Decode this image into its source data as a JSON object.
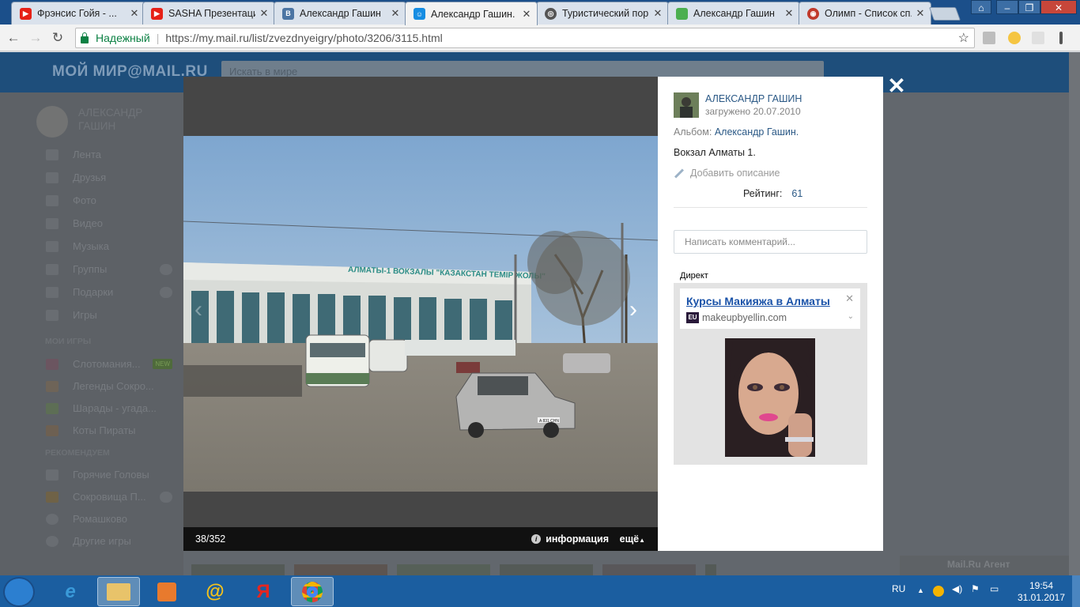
{
  "browser": {
    "tabs": [
      {
        "title": "Фрэнсис Гойя - ...",
        "icon": "youtube-icon",
        "color": "#e62117"
      },
      {
        "title": "SASHA Презентаци...",
        "icon": "youtube-icon",
        "color": "#e62117"
      },
      {
        "title": "Александр Гашин",
        "icon": "vk-icon",
        "color": "#4c75a3"
      },
      {
        "title": "Александр Гашин.",
        "icon": "mailru-icon",
        "color": "#168de2"
      },
      {
        "title": "Туристический пор...",
        "icon": "globe-icon",
        "color": "#555555"
      },
      {
        "title": "Александр Гашин",
        "icon": "page-icon",
        "color": "#4caf50"
      },
      {
        "title": "Олимп - Список сп...",
        "icon": "olimp-icon",
        "color": "#c0392b"
      }
    ],
    "active_tab": 3,
    "secure_label": "Надежный",
    "url": "https://my.mail.ru/list/zvezdnyeigry/photo/3206/3115.html"
  },
  "mymail": {
    "logo": "МОЙ МИР@MAIL.RU",
    "search_placeholder": "Искать в мире",
    "user_name": "АЛЕКСАНДР ГАШИН",
    "menu": [
      "Лента",
      "Друзья",
      "Фото",
      "Видео",
      "Музыка",
      "Группы",
      "Подарки",
      "Игры"
    ],
    "my_games_title": "МОИ ИГРЫ",
    "my_games": [
      "Слотомания...",
      "Легенды Сокро...",
      "Шарады - угада...",
      "Коты Пираты"
    ],
    "new_badge": "NEW",
    "recommend_title": "РЕКОМЕНДУЕМ",
    "recommended": [
      "Горячие Головы",
      "Сокровища П...",
      "Ромашково",
      "Другие игры"
    ],
    "agent_label": "Mail.Ru Агент"
  },
  "viewer": {
    "counter": "38/352",
    "info_label": "информация",
    "more_label": "ещё",
    "sign_text": "АЛМАТЫ-1 ВОКЗАЛЫ \"КАЗАКСТАН ТЕМІР ЖОЛЫ\"",
    "plate_text": "A 831 CHN"
  },
  "sidebar": {
    "user": "АЛЕКСАНДР ГАШИН",
    "uploaded": "загружено 20.07.2010",
    "album_label": "Альбом:",
    "album_name": "Александр Гашин.",
    "description": "Вокзал Алматы 1.",
    "add_description": "Добавить описание",
    "rating_label": "Рейтинг:",
    "rating_value": "61",
    "comment_placeholder": "Написать комментарий...",
    "direct_label": "Директ",
    "ad_title": "Курсы Макияжа в Алматы",
    "ad_url": "makeupbyellin.com",
    "ad_logo": "EU"
  },
  "taskbar": {
    "lang": "RU",
    "time": "19:54",
    "date": "31.01.2017"
  }
}
